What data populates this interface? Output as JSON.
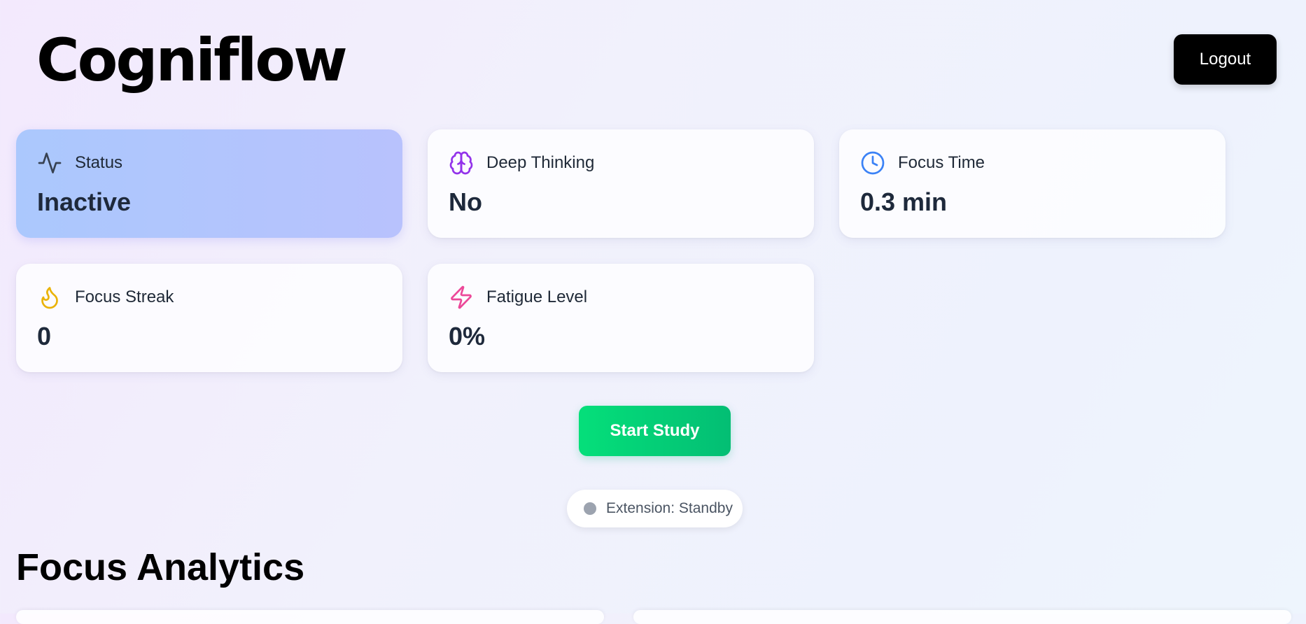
{
  "app": {
    "title": "Cogniflow"
  },
  "header": {
    "logout_label": "Logout"
  },
  "cards": [
    {
      "label": "Status",
      "value": "Inactive",
      "icon": "activity-icon",
      "icon_color": "#374151"
    },
    {
      "label": "Deep Thinking",
      "value": "No",
      "icon": "brain-icon",
      "icon_color": "#9333ea"
    },
    {
      "label": "Focus Time",
      "value": "0.3 min",
      "icon": "clock-icon",
      "icon_color": "#3b82f6"
    },
    {
      "label": "Focus Streak",
      "value": "0",
      "icon": "flame-icon",
      "icon_color": "#eab308"
    },
    {
      "label": "Fatigue Level",
      "value": "0%",
      "icon": "zap-icon",
      "icon_color": "#ec4899"
    }
  ],
  "actions": {
    "start_label": "Start Study"
  },
  "extension": {
    "status_text": "Extension: Standby",
    "dot_color": "#9ca3af"
  },
  "analytics": {
    "title": "Focus Analytics"
  },
  "colors": {
    "start_button": "#05df7a",
    "status_card_tint": "#b8c2fd"
  }
}
